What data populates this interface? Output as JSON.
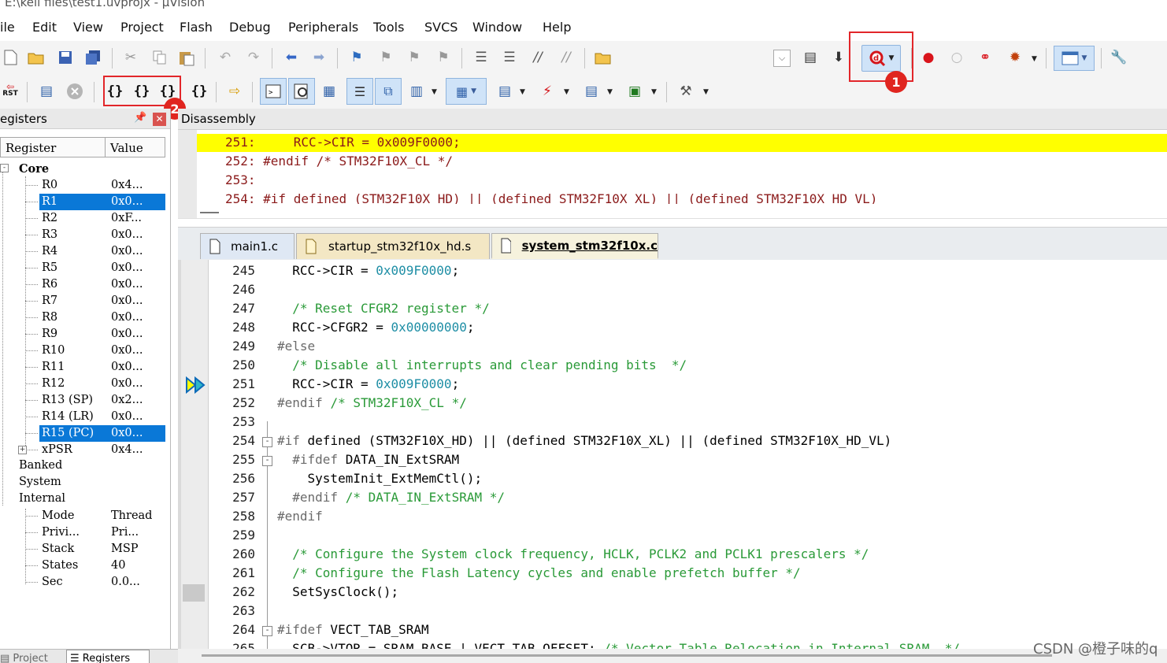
{
  "title_bar": "E:\\keil files\\test1.uvprojx - µVision",
  "menu": [
    "ile",
    "Edit",
    "View",
    "Project",
    "Flash",
    "Debug",
    "Peripherals",
    "Tools",
    "SVCS",
    "Window",
    "Help"
  ],
  "annotations": {
    "badge1": "1",
    "badge2": "2"
  },
  "toolbar2": {
    "rst_label": "RST"
  },
  "registers": {
    "panel_title": "egisters",
    "col_register": "Register",
    "col_value": "Value",
    "core": "Core",
    "rows": [
      {
        "name": "R0",
        "value": "0x4..."
      },
      {
        "name": "R1",
        "value": "0x0..."
      },
      {
        "name": "R2",
        "value": "0xF..."
      },
      {
        "name": "R3",
        "value": "0x0..."
      },
      {
        "name": "R4",
        "value": "0x0..."
      },
      {
        "name": "R5",
        "value": "0x0..."
      },
      {
        "name": "R6",
        "value": "0x0..."
      },
      {
        "name": "R7",
        "value": "0x0..."
      },
      {
        "name": "R8",
        "value": "0x0..."
      },
      {
        "name": "R9",
        "value": "0x0..."
      },
      {
        "name": "R10",
        "value": "0x0..."
      },
      {
        "name": "R11",
        "value": "0x0..."
      },
      {
        "name": "R12",
        "value": "0x0..."
      },
      {
        "name": "R13 (SP)",
        "value": "0x2..."
      },
      {
        "name": "R14 (LR)",
        "value": "0x0..."
      },
      {
        "name": "R15 (PC)",
        "value": "0x0..."
      },
      {
        "name": "xPSR",
        "value": "0x4..."
      }
    ],
    "groups": [
      "Banked",
      "System",
      "Internal"
    ],
    "internal_rows": [
      {
        "name": "Mode",
        "value": "Thread"
      },
      {
        "name": "Privi...",
        "value": "Pri..."
      },
      {
        "name": "Stack",
        "value": "MSP"
      },
      {
        "name": "States",
        "value": "40"
      },
      {
        "name": "Sec",
        "value": "0.0..."
      }
    ],
    "bottom_tabs": [
      "Project",
      "Registers"
    ]
  },
  "disassembly": {
    "title": "Disassembly",
    "lines": [
      "251:     RCC->CIR = 0x009F0000;",
      "252: #endif /* STM32F10X_CL */",
      "253:",
      "254: #if defined (STM32F10X_HD) || (defined STM32F10X_XL) || (defined STM32F10X_HD_VL)"
    ]
  },
  "editor": {
    "tabs": [
      "main1.c",
      "startup_stm32f10x_hd.s",
      "system_stm32f10x.c"
    ],
    "active_tab": "system_stm32f10x.c",
    "lines": [
      {
        "num": "245",
        "text": "  RCC->CIR = 0x009F0000;"
      },
      {
        "num": "246",
        "text": ""
      },
      {
        "num": "247",
        "text": "  /* Reset CFGR2 register */"
      },
      {
        "num": "248",
        "text": "  RCC->CFGR2 = 0x00000000;"
      },
      {
        "num": "249",
        "text": "#else"
      },
      {
        "num": "250",
        "text": "  /* Disable all interrupts and clear pending bits  */"
      },
      {
        "num": "251",
        "text": "  RCC->CIR = 0x009F0000;"
      },
      {
        "num": "252",
        "text": "#endif /* STM32F10X_CL */"
      },
      {
        "num": "253",
        "text": ""
      },
      {
        "num": "254",
        "text": "#if defined (STM32F10X_HD) || (defined STM32F10X_XL) || (defined STM32F10X_HD_VL)"
      },
      {
        "num": "255",
        "text": "  #ifdef DATA_IN_ExtSRAM"
      },
      {
        "num": "256",
        "text": "    SystemInit_ExtMemCtl();"
      },
      {
        "num": "257",
        "text": "  #endif /* DATA_IN_ExtSRAM */"
      },
      {
        "num": "258",
        "text": "#endif"
      },
      {
        "num": "259",
        "text": ""
      },
      {
        "num": "260",
        "text": "  /* Configure the System clock frequency, HCLK, PCLK2 and PCLK1 prescalers */"
      },
      {
        "num": "261",
        "text": "  /* Configure the Flash Latency cycles and enable prefetch buffer */"
      },
      {
        "num": "262",
        "text": "  SetSysClock();"
      },
      {
        "num": "263",
        "text": ""
      },
      {
        "num": "264",
        "text": "#ifdef VECT_TAB_SRAM"
      },
      {
        "num": "265",
        "text": "  SCB->VTOR = SRAM_BASE | VECT_TAB_OFFSET; /* Vector Table Relocation in Internal SRAM. */"
      }
    ]
  },
  "watermark": "CSDN @橙子味的q"
}
